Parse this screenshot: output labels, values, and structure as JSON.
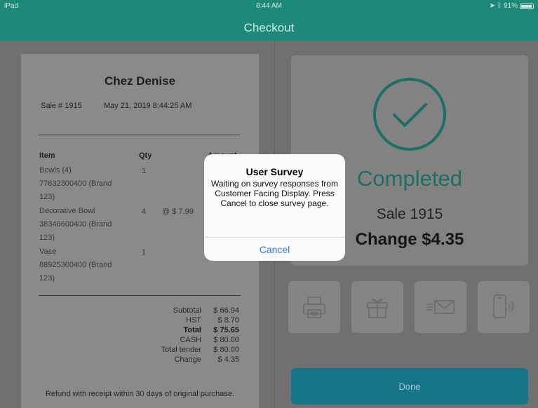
{
  "status_bar": {
    "device": "iPad",
    "time": "8:44 AM",
    "battery": "91%"
  },
  "nav": {
    "title": "Checkout"
  },
  "receipt": {
    "store_name": "Chez Denise",
    "sale_number": "Sale # 1915",
    "sale_date": "May 21, 2019 8:44:25 AM",
    "headers": {
      "item": "Item",
      "qty": "Qty",
      "amount": "Amount"
    },
    "items": [
      {
        "lines": [
          "Bowls (4)",
          "77632300400 (Brand",
          "123)"
        ],
        "qty": "1",
        "price": ""
      },
      {
        "lines": [
          "Decorative Bowl",
          "38346600400 (Brand",
          "123)"
        ],
        "qty": "4",
        "price": "@ $ 7.99"
      },
      {
        "lines": [
          "Vase",
          "88925300400 (Brand",
          "123)"
        ],
        "qty": "1",
        "price": ""
      }
    ],
    "totals": [
      {
        "label": "Subtotal",
        "value": "$ 66.94",
        "bold": false
      },
      {
        "label": "HST",
        "value": "$ 8.70",
        "bold": false
      },
      {
        "label": "Total",
        "value": "$ 75.65",
        "bold": true
      },
      {
        "label": "CASH",
        "value": "$ 80.00",
        "bold": false
      },
      {
        "label": "Total tender",
        "value": "$ 80.00",
        "bold": false
      },
      {
        "label": "Change",
        "value": "$ 4.35",
        "bold": false
      }
    ],
    "refund_note": "Refund with receipt within 30 days of original purchase."
  },
  "completion": {
    "status": "Completed",
    "sale": "Sale 1915",
    "change": "Change $4.35",
    "actions": [
      {
        "name": "print-receipt-button",
        "icon": "printer-icon"
      },
      {
        "name": "gift-receipt-button",
        "icon": "gift-icon"
      },
      {
        "name": "email-receipt-button",
        "icon": "email-icon"
      },
      {
        "name": "text-receipt-button",
        "icon": "phone-icon"
      }
    ],
    "done_label": "Done"
  },
  "dialog": {
    "title": "User Survey",
    "message": "Waiting on survey responses from Customer Facing Display. Press Cancel to close survey page.",
    "cancel_label": "Cancel"
  },
  "colors": {
    "header": "#1d8a79",
    "accent": "#1b6f63",
    "done_button": "#15768a",
    "dialog_link": "#2f7de0"
  }
}
